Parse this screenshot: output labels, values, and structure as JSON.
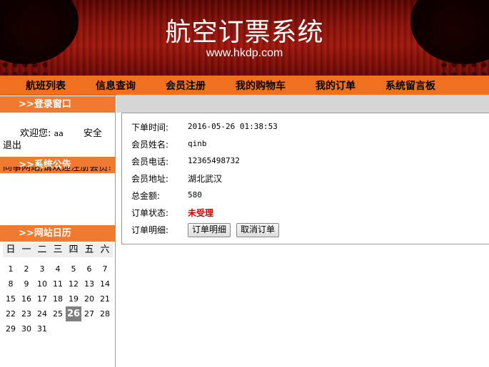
{
  "header": {
    "title": "航空订票系统",
    "url": "www.hkdp.com"
  },
  "nav": {
    "items": [
      "航班列表",
      "信息查询",
      "会员注册",
      "我的购物车",
      "我的订单",
      "系统留言板"
    ]
  },
  "login": {
    "title": ">>登录窗口",
    "welcome_label": "欢迎您:",
    "username": "aa",
    "safe_exit_1": "安全",
    "safe_exit_2": "退出"
  },
  "announcement": {
    "title": ">>系统公告",
    "text": "同事网站,请欢迎注册会员!"
  },
  "calendar": {
    "title": ">>网站日历",
    "weekdays": [
      "日",
      "一",
      "二",
      "三",
      "四",
      "五",
      "六"
    ],
    "weeks": [
      [
        "1",
        "2",
        "3",
        "4",
        "5",
        "6",
        "7"
      ],
      [
        "8",
        "9",
        "10",
        "11",
        "12",
        "13",
        "14"
      ],
      [
        "15",
        "16",
        "17",
        "18",
        "19",
        "20",
        "21"
      ],
      [
        "22",
        "23",
        "24",
        "25",
        "26",
        "27",
        "28"
      ],
      [
        "29",
        "30",
        "31",
        "",
        "",
        "",
        ""
      ]
    ],
    "today": "26"
  },
  "order": {
    "fields": [
      {
        "label": "下单时间:",
        "value": "2016-05-26 01:38:53"
      },
      {
        "label": "会员姓名:",
        "value": "qinb"
      },
      {
        "label": "会员电话:",
        "value": "12365498732"
      },
      {
        "label": "会员地址:",
        "value": "湖北武汉"
      },
      {
        "label": "总金额:",
        "value": "580"
      },
      {
        "label": "订单状态:",
        "value": "未受理"
      },
      {
        "label": "订单明细:",
        "value": ""
      }
    ],
    "detail_button": "订单明细",
    "cancel_button": "取消订单",
    "status_color": "#d40000"
  },
  "colors": {
    "nav_bg": "#f07020",
    "section_bg": "#f07a30",
    "banner_red": "#a0190f"
  }
}
